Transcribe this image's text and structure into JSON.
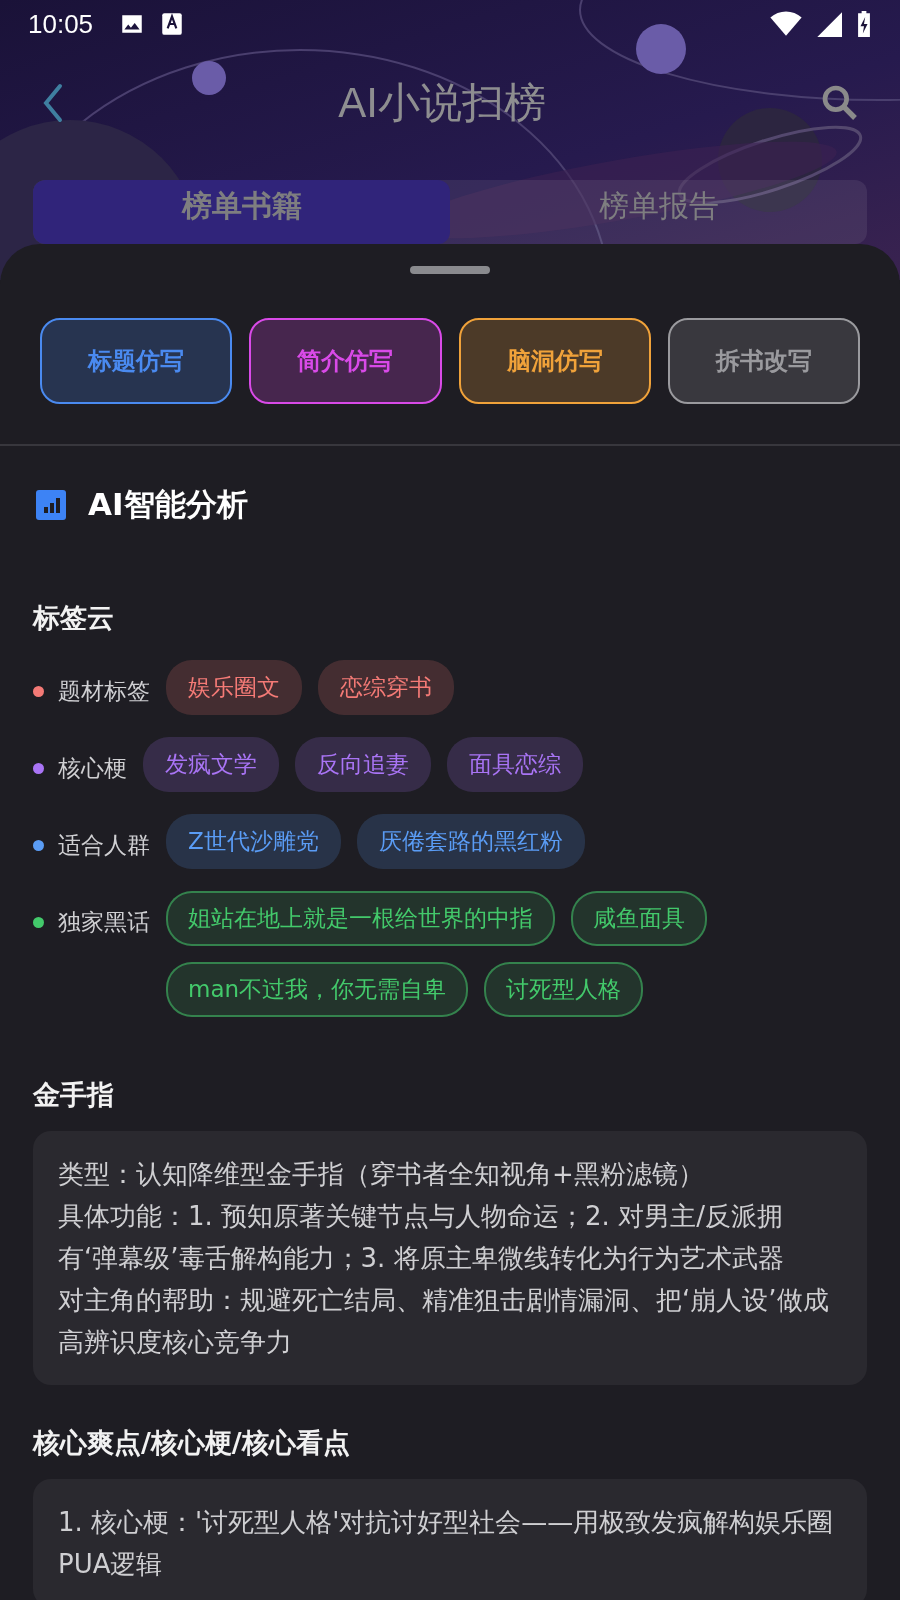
{
  "status_bar": {
    "time": "10:05"
  },
  "header": {
    "title": "AI小说扫榜"
  },
  "tabs": [
    {
      "label": "榜单书籍",
      "selected": true
    },
    {
      "label": "榜单报告",
      "selected": false
    }
  ],
  "actions": [
    {
      "label": "标题仿写",
      "color": "#4a8af0"
    },
    {
      "label": "简介仿写",
      "color": "#d94ae8"
    },
    {
      "label": "脑洞仿写",
      "color": "#f0a23a"
    },
    {
      "label": "拆书改写",
      "color": "#9a9a9e"
    }
  ],
  "analysis": {
    "title": "AI智能分析",
    "tag_cloud": {
      "title": "标签云",
      "groups": [
        {
          "label": "题材标签",
          "color": "#f47a76",
          "kind": "filled",
          "tags": [
            "娱乐圈文",
            "恋综穿书"
          ]
        },
        {
          "label": "核心梗",
          "color": "#a974f5",
          "kind": "filled",
          "tags": [
            "发疯文学",
            "反向追妻",
            "面具恋综"
          ]
        },
        {
          "label": "适合人群",
          "color": "#5a9cf5",
          "kind": "filled",
          "tags": [
            "Z世代沙雕党",
            "厌倦套路的黑红粉"
          ]
        },
        {
          "label": "独家黑话",
          "color": "#43c96b",
          "kind": "outlined",
          "tags": [
            "姐站在地上就是一根给世界的中指",
            "咸鱼面具",
            "man不过我，你无需自卑",
            "讨死型人格"
          ]
        }
      ]
    },
    "sections": [
      {
        "title": "金手指",
        "paragraphs": [
          "类型：认知降维型金手指（穿书者全知视角+黑粉滤镜）",
          "具体功能：1. 预知原著关键节点与人物命运；2. 对男主/反派拥有‘弹幕级’毒舌解构能力；3. 将原主卑微线转化为行为艺术武器",
          "对主角的帮助：规避死亡结局、精准狙击剧情漏洞、把‘崩人设’做成高辨识度核心竞争力"
        ]
      },
      {
        "title": "核心爽点/核心梗/核心看点",
        "paragraphs": [
          "1. 核心梗：'讨死型人格'对抗讨好型社会——用极致发疯解构娱乐圈PUA逻辑"
        ]
      }
    ]
  }
}
